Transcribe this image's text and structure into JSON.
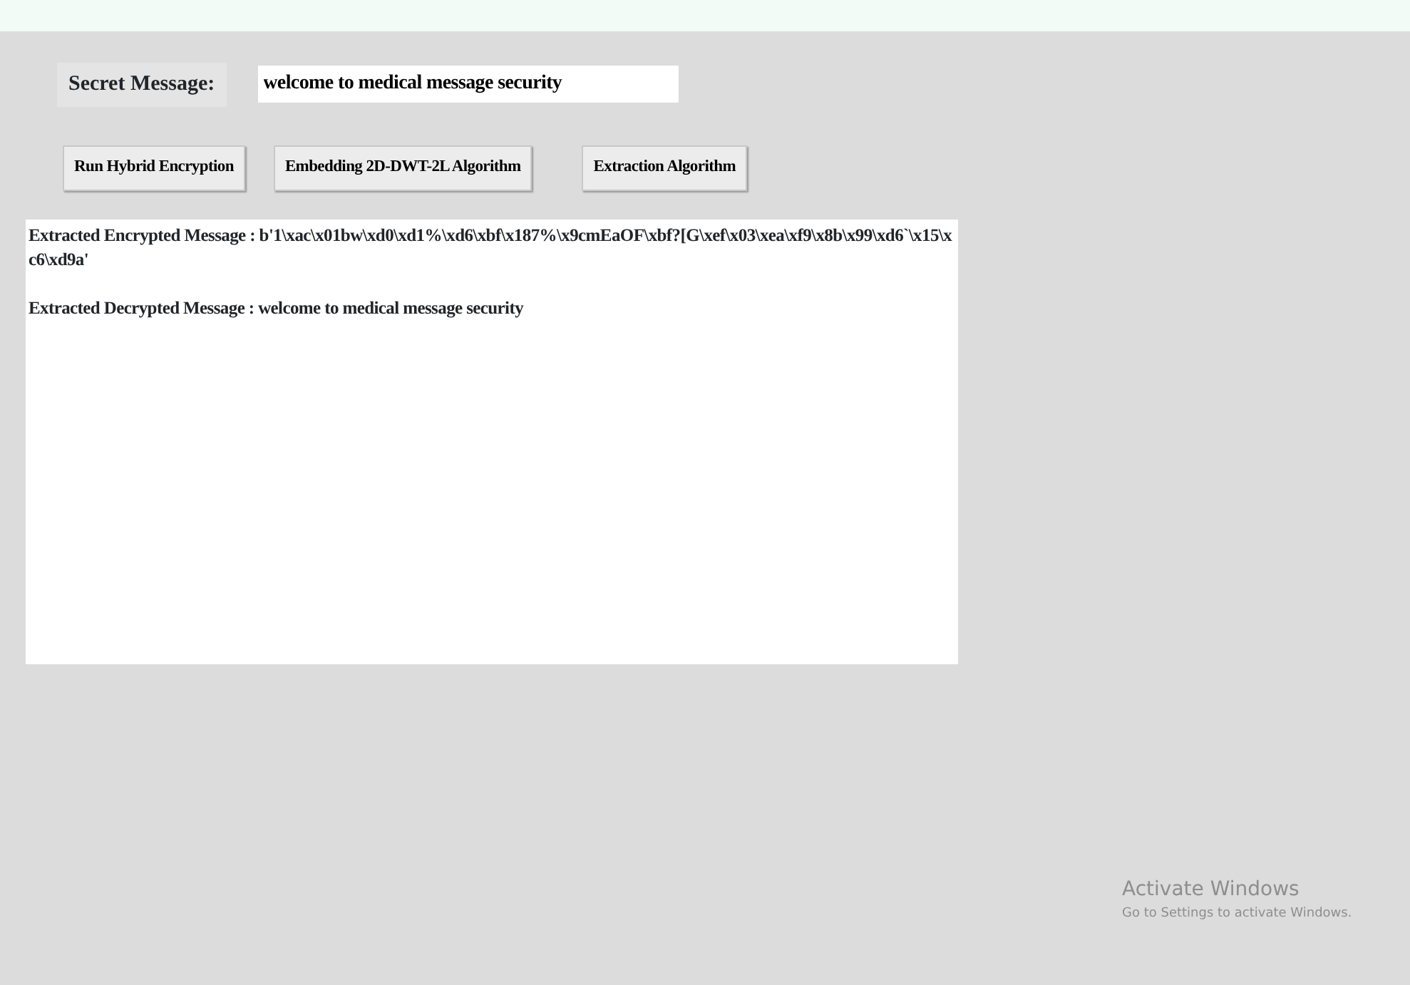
{
  "secret_message": {
    "label": "Secret Message:",
    "value": "welcome to medical message security"
  },
  "buttons": [
    {
      "label": "Run Hybrid Encryption"
    },
    {
      "label": "Embedding 2D-DWT-2L Algorithm"
    },
    {
      "label": "Extraction Algorithm"
    }
  ],
  "output_lines": [
    "Extracted Encrypted Message : b'1\\xac\\x01bw\\xd0\\xd1%\\xd6\\xbf\\x187%\\x9cmEaOF\\xbf?[G\\xef\\x03\\xea\\xf9\\x8b\\x99\\xd6`\\x15\\xc6\\xd9a'",
    "Extracted Decrypted Message : welcome to medical message security"
  ],
  "activation_notice": {
    "title": "Activate Windows",
    "subtitle": "Go to Settings to activate Windows."
  }
}
